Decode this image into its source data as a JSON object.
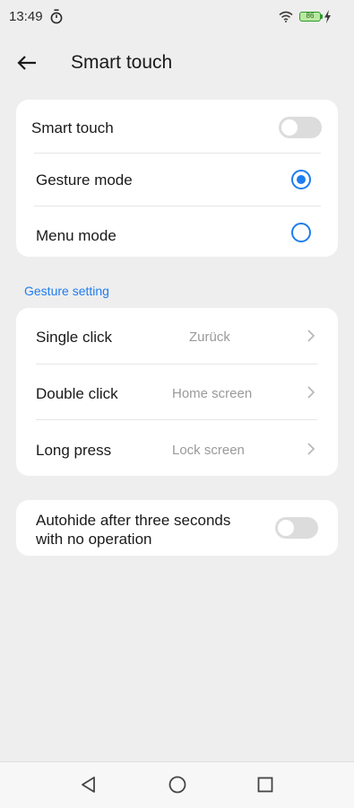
{
  "status_bar": {
    "time": "13:49",
    "battery_level": "86",
    "icons": [
      "timer-icon",
      "wifi-icon",
      "battery-icon",
      "charging-icon"
    ]
  },
  "header": {
    "title": "Smart touch",
    "back_icon": "arrow-left-icon"
  },
  "smart_touch_card": {
    "toggle_label": "Smart touch",
    "toggle_on": false,
    "options": [
      {
        "label": "Gesture mode",
        "selected": true
      },
      {
        "label": "Menu mode",
        "selected": false
      }
    ]
  },
  "gesture_setting": {
    "section_title": "Gesture setting",
    "rows": [
      {
        "label": "Single click",
        "value": "Zurück"
      },
      {
        "label": "Double click",
        "value": "Home screen"
      },
      {
        "label": "Long press",
        "value": "Lock screen"
      }
    ]
  },
  "autohide": {
    "label": "Autohide after three seconds with no operation",
    "toggle_on": false
  },
  "nav_bar": {
    "buttons": [
      "back-triangle-icon",
      "home-circle-icon",
      "recents-square-icon"
    ]
  },
  "colors": {
    "accent": "#1e7df0",
    "background": "#eeeeee",
    "card": "#ffffff",
    "secondary_text": "#9a9a9a"
  }
}
